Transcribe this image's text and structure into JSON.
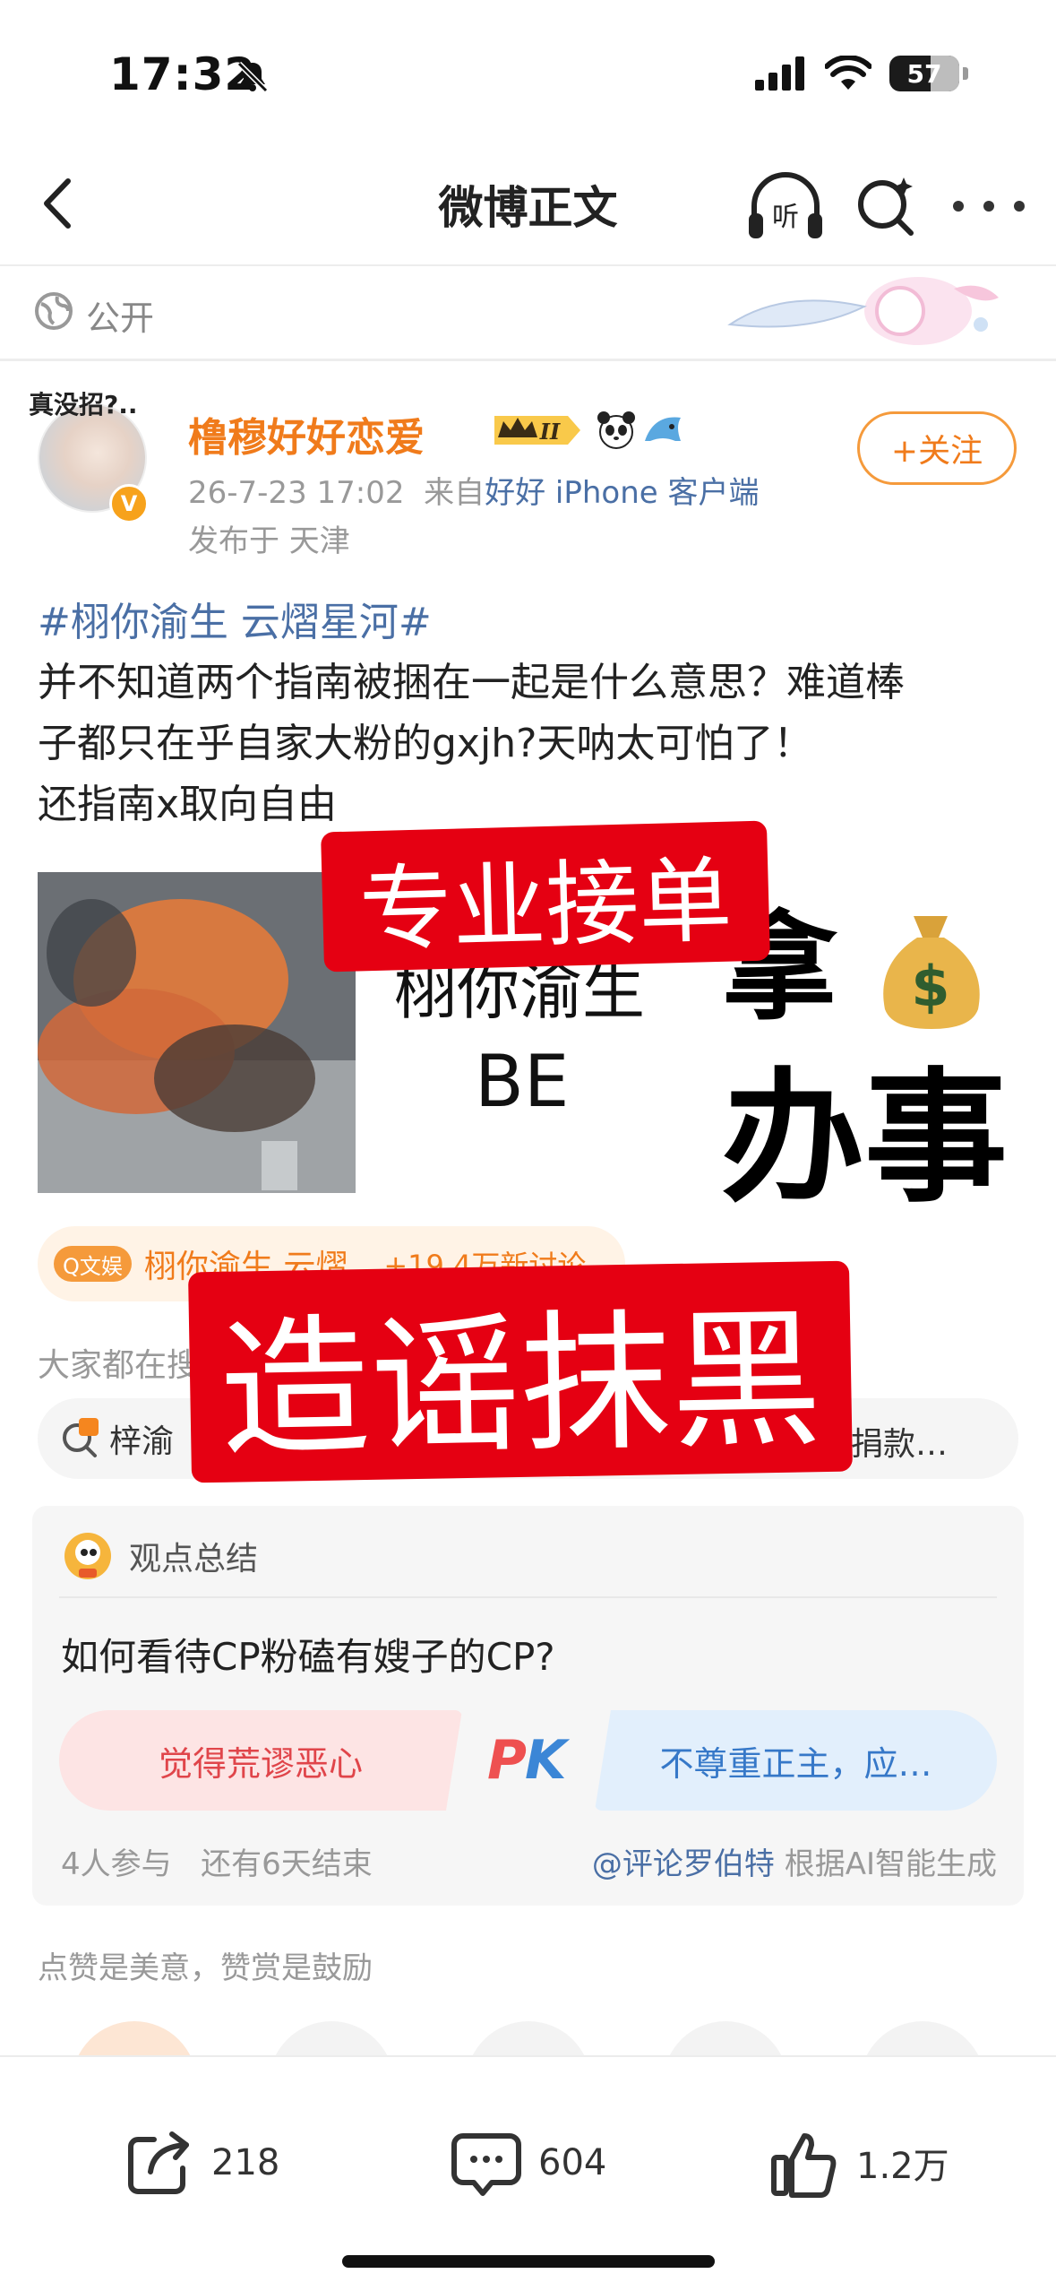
{
  "status": {
    "time": "17:32",
    "battery": "57",
    "icons": [
      "bell-slash-icon",
      "cellular-signal-icon",
      "wifi-icon",
      "battery-icon"
    ]
  },
  "nav": {
    "title": "微博正文",
    "back_icon": "chevron-left-icon",
    "listen_label": "听",
    "icons": [
      "headphones-icon",
      "search-icon",
      "more-icon"
    ]
  },
  "visibility": {
    "label": "公开",
    "icon": "globe-icon"
  },
  "author": {
    "name": "橹穆好好恋爱",
    "avatar_scribble": "真没招?..",
    "level": "II",
    "verified_badge": "V",
    "date": "26-7-23 17:02",
    "source_prefix": "来自",
    "source": "好好 iPhone 客户端",
    "location": "发布于 天津",
    "follow_label": "+关注"
  },
  "post": {
    "topic": "#栩你渝生 云熠星河#",
    "lines": [
      "并不知道两个指南被捆在一起是什么意思？难道棒",
      "子都只在乎自家大粉的gxjh?天呐太可怕了！",
      "还指南x取向自由"
    ]
  },
  "image": {
    "overlay_text": "栩你渝生",
    "be_text": "BE",
    "stamp_top": "专业接单",
    "big_na": "拿",
    "big_ban": "办事",
    "stamp_bottom": "造谣抹黑"
  },
  "topic_chip": {
    "tag": "Q文娱",
    "label": "栩你渝生 云熠",
    "count": "+19.4万新讨论"
  },
  "related": {
    "label": "大家都在搜",
    "hot_prefix": "梓渝",
    "hot_suffix": "捐款…"
  },
  "opinion": {
    "title": "观点总结",
    "question": "如何看待CP粉磕有嫂子的CP?",
    "left_option": "觉得荒谬恶心",
    "pk": "PK",
    "right_option": "不尊重正主，应…",
    "participants": "4人参与",
    "remaining": "还有6天结束",
    "mention": "@评论罗伯特",
    "ai_note": "根据AI智能生成"
  },
  "reward": {
    "text": "点赞是美意，赞赏是鼓励"
  },
  "actions": {
    "share_count": "218",
    "comment_count": "604",
    "like_count": "1.2万"
  },
  "colors": {
    "accent_orange": "#f07b1b",
    "link_blue": "#4a6fa5",
    "stamp_red": "#e50012"
  }
}
